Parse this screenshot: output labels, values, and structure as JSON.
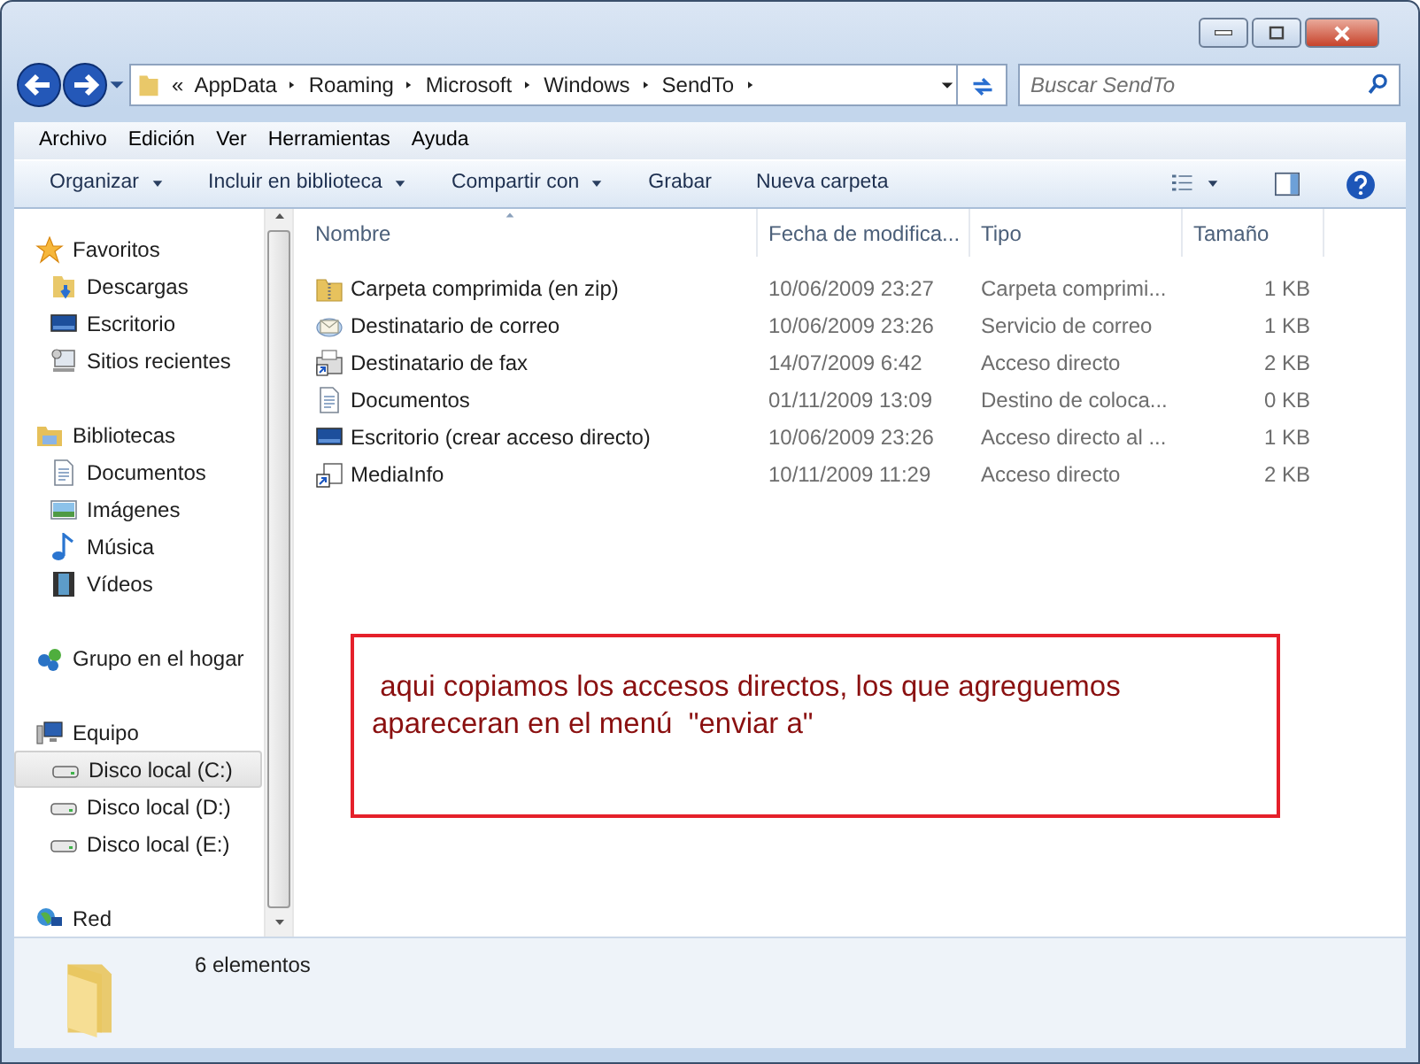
{
  "address": {
    "overflow": "«",
    "segments": [
      "AppData",
      "Roaming",
      "Microsoft",
      "Windows",
      "SendTo"
    ]
  },
  "search": {
    "placeholder": "Buscar SendTo"
  },
  "menu": [
    "Archivo",
    "Edición",
    "Ver",
    "Herramientas",
    "Ayuda"
  ],
  "toolbar": [
    {
      "label": "Organizar",
      "dropdown": true
    },
    {
      "label": "Incluir en biblioteca",
      "dropdown": true
    },
    {
      "label": "Compartir con",
      "dropdown": true
    },
    {
      "label": "Grabar",
      "dropdown": false
    },
    {
      "label": "Nueva carpeta",
      "dropdown": false
    }
  ],
  "sidebar": {
    "groups": [
      {
        "label": "Favoritos",
        "kind": "star",
        "selected": false,
        "children": [
          {
            "label": "Descargas",
            "kind": "downloads",
            "selected": false
          },
          {
            "label": "Escritorio",
            "kind": "desktop",
            "selected": false
          },
          {
            "label": "Sitios recientes",
            "kind": "recent",
            "selected": false
          }
        ]
      },
      {
        "label": "Bibliotecas",
        "kind": "library",
        "selected": false,
        "children": [
          {
            "label": "Documentos",
            "kind": "document",
            "selected": false
          },
          {
            "label": "Imágenes",
            "kind": "images",
            "selected": false
          },
          {
            "label": "Música",
            "kind": "music",
            "selected": false
          },
          {
            "label": "Vídeos",
            "kind": "video",
            "selected": false
          }
        ]
      },
      {
        "label": "Grupo en el hogar",
        "kind": "homegroup",
        "selected": false
      },
      {
        "label": "Equipo",
        "kind": "computer",
        "selected": false,
        "children": [
          {
            "label": "Disco local (C:)",
            "kind": "drive",
            "selected": true
          },
          {
            "label": "Disco local (D:)",
            "kind": "drive",
            "selected": false
          },
          {
            "label": "Disco local (E:)",
            "kind": "drive",
            "selected": false
          }
        ]
      },
      {
        "label": "Red",
        "kind": "network",
        "selected": false
      }
    ]
  },
  "table": {
    "columns": [
      "Nombre",
      "Fecha de modifica...",
      "Tipo",
      "Tamaño"
    ],
    "rows": [
      {
        "kind": "zip",
        "cells": [
          "Carpeta comprimida (en zip)",
          "10/06/2009 23:27",
          "Carpeta comprimi...",
          "1 KB"
        ]
      },
      {
        "kind": "mail",
        "cells": [
          "Destinatario de correo",
          "10/06/2009 23:26",
          "Servicio de correo",
          "1 KB"
        ]
      },
      {
        "kind": "fax",
        "cells": [
          "Destinatario de fax",
          "14/07/2009 6:42",
          "Acceso directo",
          "2 KB"
        ]
      },
      {
        "kind": "document",
        "cells": [
          "Documentos",
          "01/11/2009 13:09",
          "Destino de coloca...",
          "0 KB"
        ]
      },
      {
        "kind": "desktop",
        "cells": [
          "Escritorio (crear acceso directo)",
          "10/06/2009 23:26",
          "Acceso directo al ...",
          "1 KB"
        ]
      },
      {
        "kind": "shortcut",
        "cells": [
          "MediaInfo",
          "10/11/2009 11:29",
          "Acceso directo",
          "2 KB"
        ]
      }
    ]
  },
  "annotation": {
    "lines": [
      " aqui copiamos los accesos directos, los que agreguemos",
      "apareceran en el menú  \"enviar a\""
    ]
  },
  "status_bar": {
    "text": "6 elementos"
  }
}
